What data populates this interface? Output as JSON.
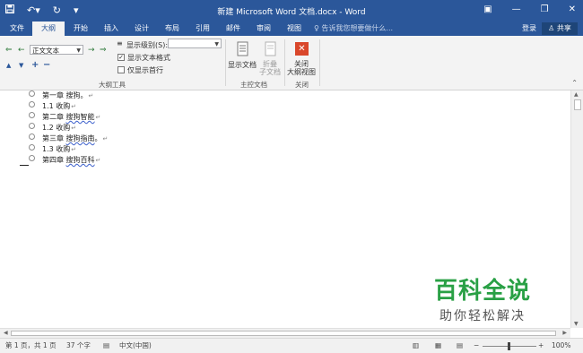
{
  "window": {
    "title": "新建 Microsoft Word 文档.docx - Word",
    "qat_icons": [
      "save-icon",
      "undo-icon",
      "redo-icon",
      "customize-icon"
    ],
    "window_icons": [
      "ribbon-display-icon",
      "minimize-icon",
      "restore-icon",
      "close-icon"
    ]
  },
  "tabs": [
    "文件",
    "大纲",
    "开始",
    "插入",
    "设计",
    "布局",
    "引用",
    "邮件",
    "审阅",
    "视图"
  ],
  "active_tab": "大纲",
  "tell_me": "告诉我您想要做什么...",
  "login": "登录",
  "share": "共享",
  "ribbon": {
    "outline_tools": {
      "label": "大纲工具",
      "level_value": "正文文本",
      "show_level_label": "显示级别(S):",
      "show_level_value": "",
      "show_text_format_label": "显示文本格式",
      "show_text_format_checked": true,
      "show_first_line_label": "仅显示首行",
      "show_first_line_checked": false
    },
    "master_doc": {
      "label": "主控文档",
      "show_document": "显示文档",
      "collapse_subdocs": "折叠\n子文档"
    },
    "close": {
      "label": "关闭",
      "close_outline_view": "关闭\n大纲视图"
    }
  },
  "document": {
    "lines": [
      {
        "prefix": "第一章 ",
        "text": "搜狗",
        "suffix": "。",
        "underlined": false
      },
      {
        "prefix": "1.1 ",
        "text": "收购",
        "suffix": "",
        "underlined": false
      },
      {
        "prefix": "第二章 ",
        "text": "搜狗智能",
        "suffix": "",
        "underlined": true
      },
      {
        "prefix": "1.2 ",
        "text": "收购",
        "suffix": "",
        "underlined": false
      },
      {
        "prefix": "第三章 ",
        "text": "搜狗指南",
        "suffix": "。",
        "underlined": true
      },
      {
        "prefix": "1.3 ",
        "text": "收购",
        "suffix": "",
        "underlined": false
      },
      {
        "prefix": "第四章 ",
        "text": "搜狗百科",
        "suffix": "",
        "underlined": true
      }
    ],
    "paragraph_mark": "↵"
  },
  "statusbar": {
    "page": "第 1 页，共 1 页",
    "words": "37 个字",
    "language": "中文(中国)",
    "zoom": "100%"
  },
  "watermark": {
    "title": "百科全说",
    "subtitle": "助你轻松解决"
  }
}
